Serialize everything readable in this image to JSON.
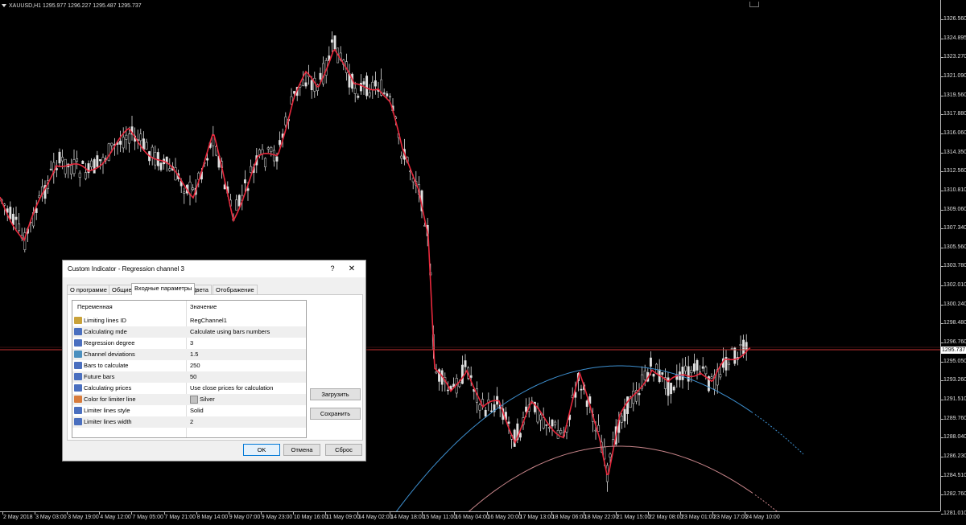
{
  "symbol_info": "XAUUSD,H1  1295.977 1296.227 1295.487 1295.737",
  "current_price": "1295.737",
  "price_axis": [
    "1326.560",
    "1324.895",
    "1323.270",
    "1321.090",
    "1319.560",
    "1317.880",
    "1316.060",
    "1314.350",
    "1312.560",
    "1310.810",
    "1309.060",
    "1307.340",
    "1305.560",
    "1303.780",
    "1302.010",
    "1300.240",
    "1298.480",
    "1296.760",
    "1295.050",
    "1293.260",
    "1291.510",
    "1289.760",
    "1288.040",
    "1286.230",
    "1284.510",
    "1282.760",
    "1281.010"
  ],
  "time_axis": [
    "2 May 2018",
    "3 May 03:00",
    "3 May 19:00",
    "4 May 12:00",
    "7 May 05:00",
    "7 May 21:00",
    "8 May 14:00",
    "9 May 07:00",
    "9 May 23:00",
    "10 May 16:00",
    "11 May 09:00",
    "14 May 02:00",
    "14 May 18:00",
    "15 May 11:00",
    "16 May 04:00",
    "16 May 20:00",
    "17 May 13:00",
    "18 May 06:00",
    "18 May 22:00",
    "21 May 15:00",
    "22 May 08:00",
    "23 May 01:00",
    "23 May 17:00",
    "24 May 10:00"
  ],
  "colors": {
    "background": "#000000",
    "candles": "#e0e0e0",
    "regression_line": "#e8283c",
    "channel_upper": "#3d8fcf",
    "channel_lower": "#c8858a",
    "price_line": "#c83232"
  },
  "dialog": {
    "title": "Custom Indicator - Regression channel 3",
    "help_label": "?",
    "close_label": "✕",
    "tabs": [
      "О программе",
      "Общие",
      "Входные параметры",
      "Цвета",
      "Отображение"
    ],
    "active_tab": "Входные параметры",
    "table_headers": {
      "variable": "Переменная",
      "value": "Значение"
    },
    "params": [
      {
        "icon": "ab",
        "name": "Limiting lines ID",
        "value": "RegChannel1"
      },
      {
        "icon": "num",
        "name": "Calculating mde",
        "value": "Calculate using bars numbers"
      },
      {
        "icon": "num",
        "name": "Regression degree",
        "value": "3"
      },
      {
        "icon": "dbl",
        "name": "Channel deviations",
        "value": "1.5"
      },
      {
        "icon": "num",
        "name": "Bars to calculate",
        "value": "250"
      },
      {
        "icon": "num",
        "name": "Future bars",
        "value": "50"
      },
      {
        "icon": "num",
        "name": "Calculating prices",
        "value": "Use close prices for calculation"
      },
      {
        "icon": "clr",
        "name": "Color for limiter line",
        "value": "Silver"
      },
      {
        "icon": "num",
        "name": "Limiter lines style",
        "value": "Solid"
      },
      {
        "icon": "num",
        "name": "Limiter lines width",
        "value": "2"
      }
    ],
    "load_button": "Загрузить",
    "save_button": "Сохранить",
    "ok_button": "OK",
    "cancel_button": "Отмена",
    "reset_button": "Сброс"
  }
}
